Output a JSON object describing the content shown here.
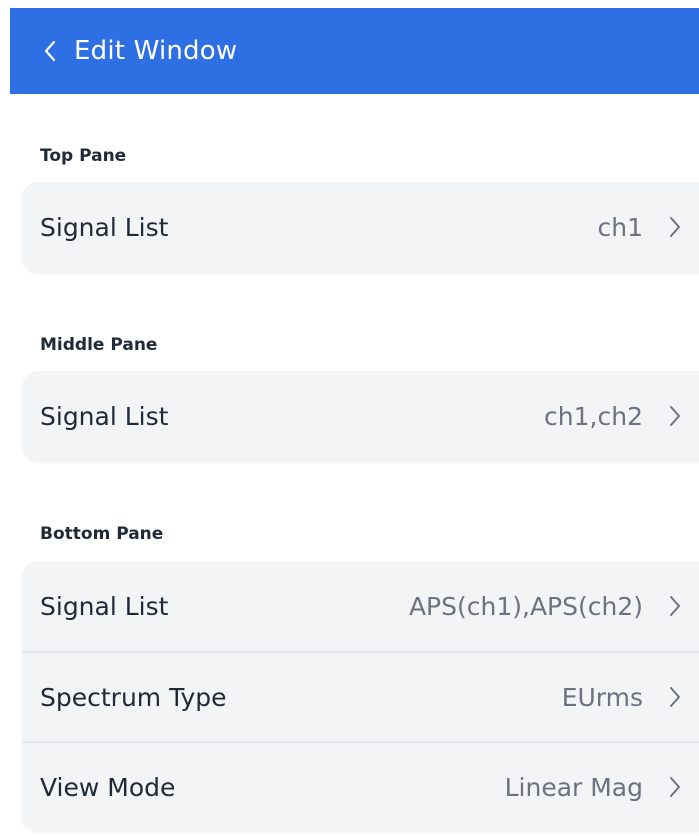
{
  "header": {
    "back_icon": "chevron-left-icon",
    "title": "Edit Window",
    "color": "#2f6fe4"
  },
  "sections": [
    {
      "title": "Top Pane",
      "rows": [
        {
          "label": "Signal List",
          "value": "ch1",
          "icon": "chevron-right-icon"
        }
      ]
    },
    {
      "title": "Middle Pane",
      "rows": [
        {
          "label": "Signal List",
          "value": "ch1,ch2",
          "icon": "chevron-right-icon"
        }
      ]
    },
    {
      "title": "Bottom Pane",
      "rows": [
        {
          "label": "Signal List",
          "value": "APS(ch1),APS(ch2)",
          "icon": "chevron-right-icon"
        },
        {
          "label": "Spectrum Type",
          "value": "EUrms",
          "icon": "chevron-right-icon"
        },
        {
          "label": "View Mode",
          "value": "Linear Mag",
          "icon": "chevron-right-icon"
        }
      ]
    }
  ]
}
